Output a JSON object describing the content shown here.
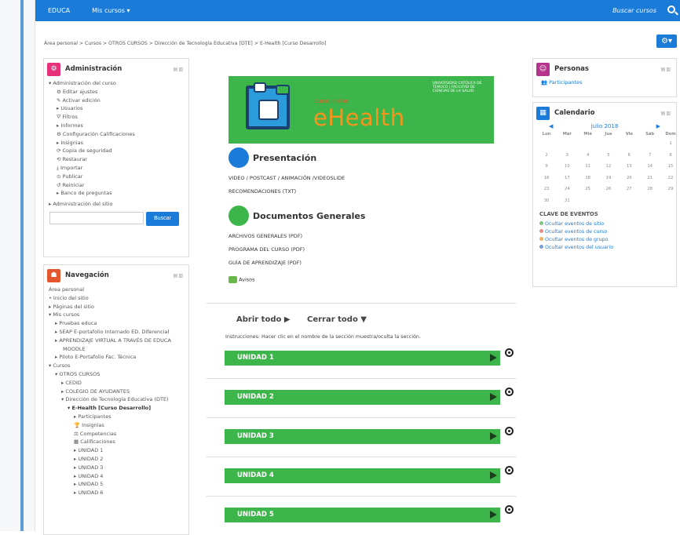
{
  "topbar": {
    "brand": "EDUCA",
    "menu": "Mis cursos ▾",
    "search_placeholder": "Buscar cursos"
  },
  "breadcrumb": "Área personal > Cursos > OTROS CURSOS > Dirección de Tecnología Educativa [DTE] > E-Health [Curso Desarrollo]",
  "admin": {
    "title": "Administración",
    "items": [
      "▾ Administración del curso",
      "⚙ Editar ajustes",
      "✎ Activar edición",
      "▸ Usuarios",
      "⛛ Filtros",
      "▸ Informes",
      "⚙ Configuración Calificaciones",
      "▸ Insignias",
      "⟳ Copia de seguridad",
      "⟲ Restaurar",
      "⤓ Importar",
      "⊙ Publicar",
      "↺ Reiniciar",
      "▸ Banco de preguntas"
    ],
    "site": "▸ Administración del sitio",
    "search_button": "Buscar"
  },
  "nav": {
    "title": "Navegación",
    "items": [
      "Área personal",
      "• Inicio del sitio",
      "▸ Páginas del sitio",
      "▾ Mis cursos",
      "▸ Pruebas educa",
      "▸ SEAP E-portafolio Internado ED. Diferencial",
      "▸ APRENDIZAJE VIRTUAL A TRAVÉS DE EDUCA",
      "MOODLE",
      "▸ Piloto E-Portafolio Fac. Técnica",
      "▾ Cursos",
      "▾ OTROS CURSOS",
      "▸ CEDID",
      "▸ COLEGIO DE AYUDANTES",
      "▾ Dirección de Tecnología Educativa (DTE)",
      "▾ E-Health [Curso Desarrollo]",
      "▸ Participantes",
      "🏆 Insignias",
      "⚖ Competencias",
      "▦ Calificaciones",
      "▸ UNIDAD 1",
      "▸ UNIDAD 2",
      "▸ UNIDAD 3",
      "▸ UNIDAD 4",
      "▸ UNIDAD 5",
      "▸ UNIDAD 6"
    ]
  },
  "banner": {
    "subtitle": "curso online",
    "title": "eHealth",
    "logo": "UNIVERSIDAD CATÓLICA DE TEMUCO | FACULTAD DE CIENCIAS DE LA SALUD"
  },
  "sections": {
    "presentacion": {
      "title": "Presentación",
      "links": [
        "VIDEO / POSTCAST / ANIMACIÓN /VIDEOSLIDE",
        "RECOMENDACIONES (TXT)"
      ]
    },
    "documentos": {
      "title": "Documentos Generales",
      "links": [
        "ARCHIVOS GENERALES (PDF)",
        "PROGRAMA DEL CURSO (PDF)",
        "GUÍA DE APRENDIZAJE (PDF)"
      ]
    },
    "avisos": "Avisos"
  },
  "toggles": {
    "open": "Abrir todo",
    "close": "Cerrar todo"
  },
  "instructions": "Instrucciones: Hacer clic en el nombre de la sección muestra/oculta la sección.",
  "units": [
    "UNIDAD 1",
    "UNIDAD 2",
    "UNIDAD 3",
    "UNIDAD 4",
    "UNIDAD 5"
  ],
  "personas": {
    "title": "Personas",
    "link": "Participantes"
  },
  "calendar": {
    "title": "Calendario",
    "month": "julio 2018",
    "days": [
      "Lun",
      "Mar",
      "Mié",
      "Jue",
      "Vie",
      "Sáb",
      "Dom"
    ],
    "weeks": [
      [
        "",
        "",
        "",
        "",
        "",
        "",
        "1"
      ],
      [
        "2",
        "3",
        "4",
        "5",
        "6",
        "7",
        "8"
      ],
      [
        "9",
        "10",
        "11",
        "12",
        "13",
        "14",
        "15"
      ],
      [
        "16",
        "17",
        "18",
        "19",
        "20",
        "21",
        "22"
      ],
      [
        "23",
        "24",
        "25",
        "26",
        "27",
        "28",
        "29"
      ],
      [
        "30",
        "31",
        "",
        "",
        "",
        "",
        ""
      ]
    ],
    "key_title": "CLAVE DE EVENTOS",
    "keys": [
      "Ocultar eventos de sitio",
      "Ocultar eventos de curso",
      "Ocultar eventos de grupo",
      "Ocultar eventos del usuario"
    ]
  },
  "colors": {
    "primary": "#1a7bd8",
    "green": "#3cb54a",
    "admin_icon": "#e8317a",
    "nav_icon": "#e4572e",
    "personas_icon": "#b5338a",
    "cal_icon": "#1a7bd8"
  }
}
